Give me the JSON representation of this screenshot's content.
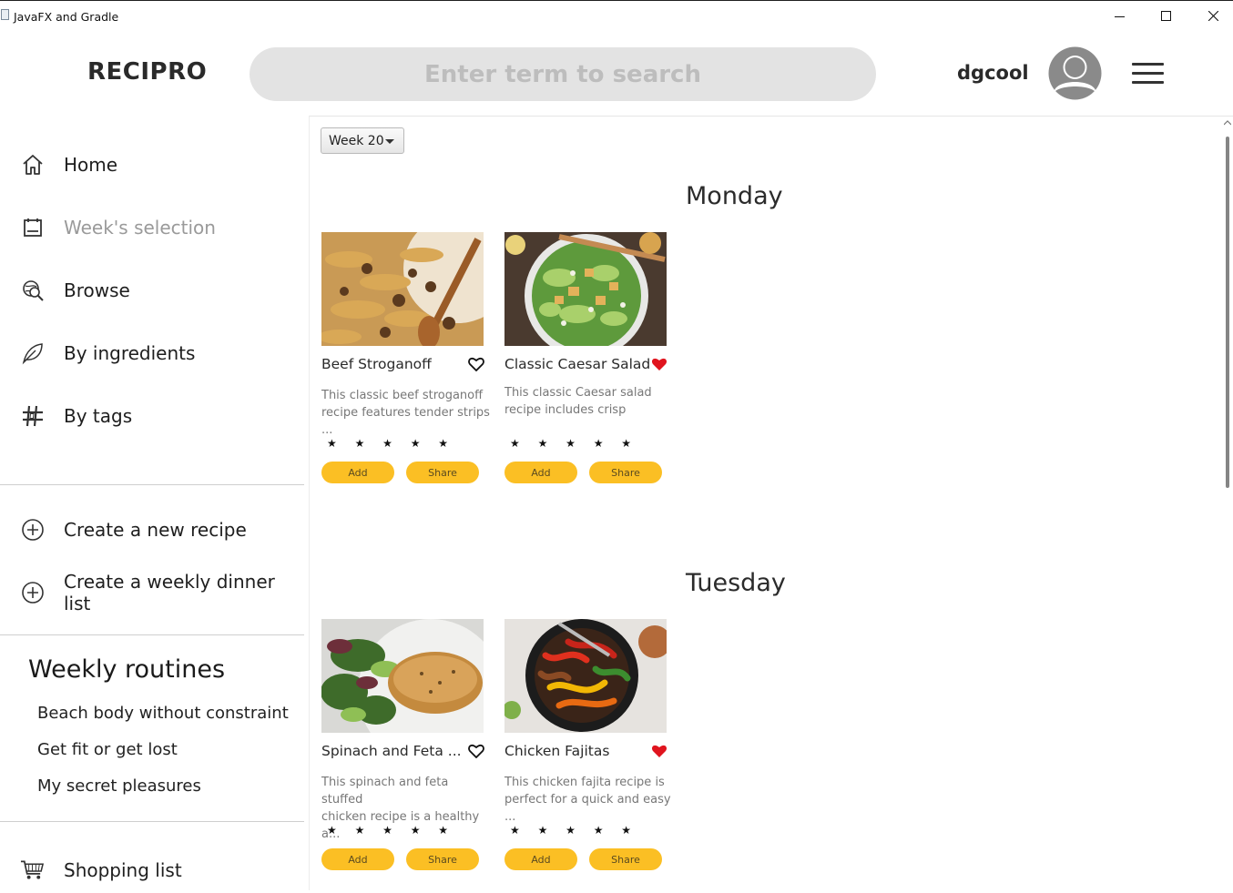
{
  "window": {
    "title": "JavaFX and Gradle"
  },
  "header": {
    "logo": "RECIPRO",
    "search_placeholder": "Enter term to search",
    "username": "dgcool"
  },
  "sidebar": {
    "nav": [
      {
        "label": "Home",
        "icon": "home-icon"
      },
      {
        "label": "Week's selection",
        "icon": "calendar-icon"
      },
      {
        "label": "Browse",
        "icon": "browse-icon"
      },
      {
        "label": "By ingredients",
        "icon": "leaf-icon"
      },
      {
        "label": "By tags",
        "icon": "hashtag-icon"
      }
    ],
    "create": [
      {
        "label": "Create a new recipe",
        "icon": "plus-circle-icon"
      },
      {
        "label": "Create a weekly dinner list",
        "icon": "plus-circle-icon"
      }
    ],
    "routines_title": "Weekly routines",
    "routines": [
      "Beach body without constraint",
      "Get fit or get lost",
      "My secret pleasures"
    ],
    "shopping": {
      "label": "Shopping list",
      "icon": "cart-icon"
    }
  },
  "week_select": {
    "value": "Week 20"
  },
  "days": [
    {
      "name": "Monday",
      "recipes": [
        {
          "name": "Beef Stroganoff",
          "desc_line1": "This classic beef stroganoff",
          "desc_line2": "recipe features tender strips ...",
          "favorite": false,
          "rating": "★ ★ ★ ★ ★",
          "add": "Add",
          "share": "Share"
        },
        {
          "name": "Classic Caesar Salad",
          "desc_line1": "This classic Caesar salad",
          "desc_line2": "recipe includes crisp",
          "favorite": true,
          "rating": "★ ★ ★ ★ ★",
          "add": "Add",
          "share": "Share"
        }
      ]
    },
    {
      "name": "Tuesday",
      "recipes": [
        {
          "name": "Spinach and Feta ...",
          "desc_line1": "This spinach and feta stuffed",
          "desc_line2": "chicken recipe is a healthy a...",
          "favorite": false,
          "rating": "★ ★ ★ ★ ★",
          "add": "Add",
          "share": "Share"
        },
        {
          "name": "Chicken Fajitas",
          "desc_line1": "This chicken fajita recipe is",
          "desc_line2": "perfect for a quick and easy ...",
          "favorite": true,
          "rating": "★ ★ ★ ★ ★",
          "add": "Add",
          "share": "Share"
        }
      ]
    }
  ],
  "colors": {
    "accent_button": "#fbbf24",
    "heart_active": "#e0141e",
    "search_bg": "#e3e3e3"
  }
}
